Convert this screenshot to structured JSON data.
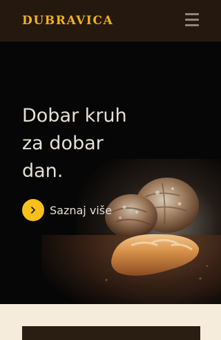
{
  "header": {
    "logo": "DUBRAVICA",
    "menu_icon": "hamburger-menu-icon"
  },
  "hero": {
    "headline_lines": [
      "Dobar kruh",
      "za dobar",
      "dan."
    ],
    "cta_label": "Saznaj više",
    "cta_icon": "chevron-right-icon",
    "image": "bread-loaves-photo"
  },
  "colors": {
    "header_bg": "#25190f",
    "logo": "#f2b21b",
    "accent": "#f7c01a",
    "hero_bg": "#060606",
    "page_bg": "#f6ecdc"
  }
}
